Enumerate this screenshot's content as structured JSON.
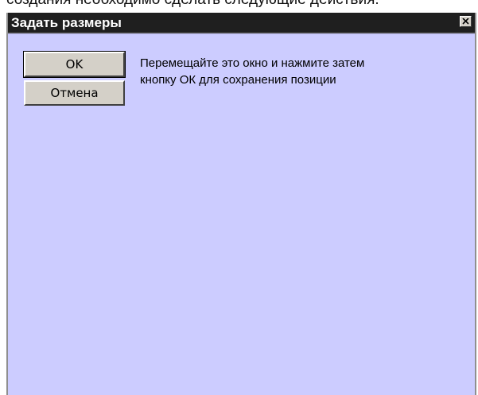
{
  "background_text": "создания необходимо сделать следующие действия:",
  "dialog": {
    "title": "Задать размеры",
    "close_glyph": "close-icon",
    "buttons": {
      "ok_label": "OK",
      "cancel_label": "Отмена"
    },
    "message": {
      "line1": "Перемещайте это окно и нажмите затем",
      "line2": "кнопку ОК для сохранения позиции"
    }
  },
  "colors": {
    "title_bar": "#1f1f1f",
    "client_area": "#ccccff",
    "button_face": "#d4d0c8"
  }
}
